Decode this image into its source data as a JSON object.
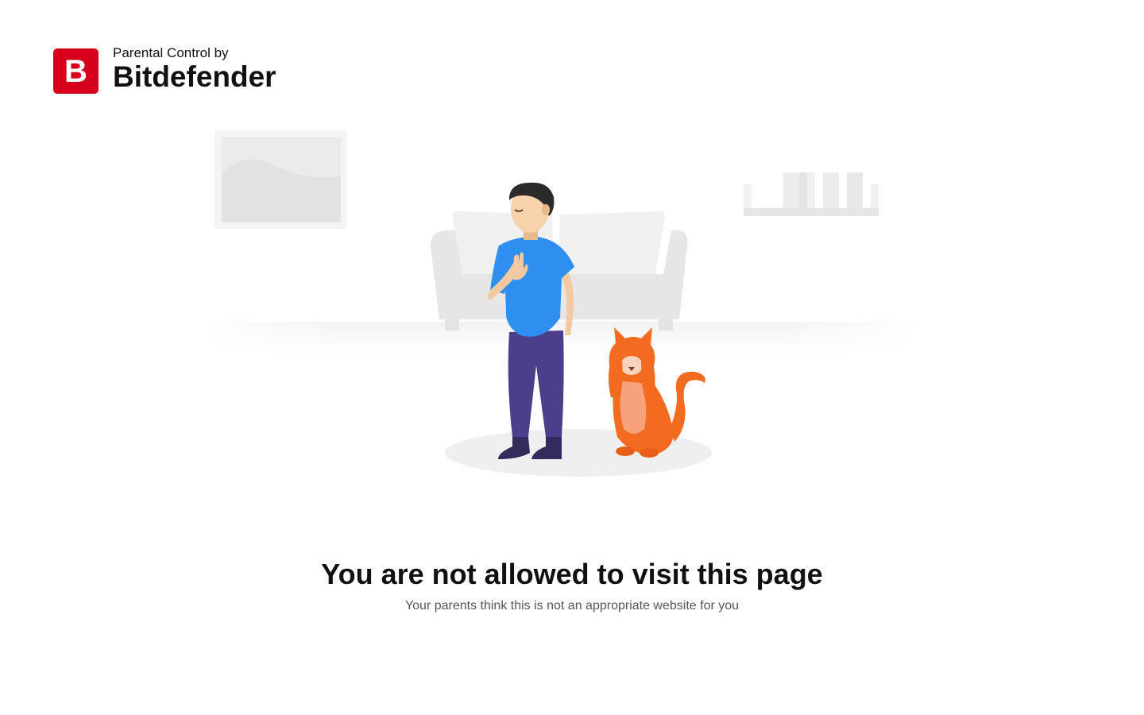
{
  "brand": {
    "logo_letter": "B",
    "tagline": "Parental Control by",
    "name": "Bitdefender",
    "color": "#d6001c"
  },
  "illustration": {
    "description_icon": "boy-and-cat-blocked-illustration",
    "colors": {
      "shirt": "#2f8ff0",
      "pants": "#4b3f8c",
      "cat": "#f26b21",
      "furniture": "#ececec"
    }
  },
  "message": {
    "title": "You are not allowed to visit this page",
    "subtitle": "Your parents think this is not an appropriate website for you"
  }
}
